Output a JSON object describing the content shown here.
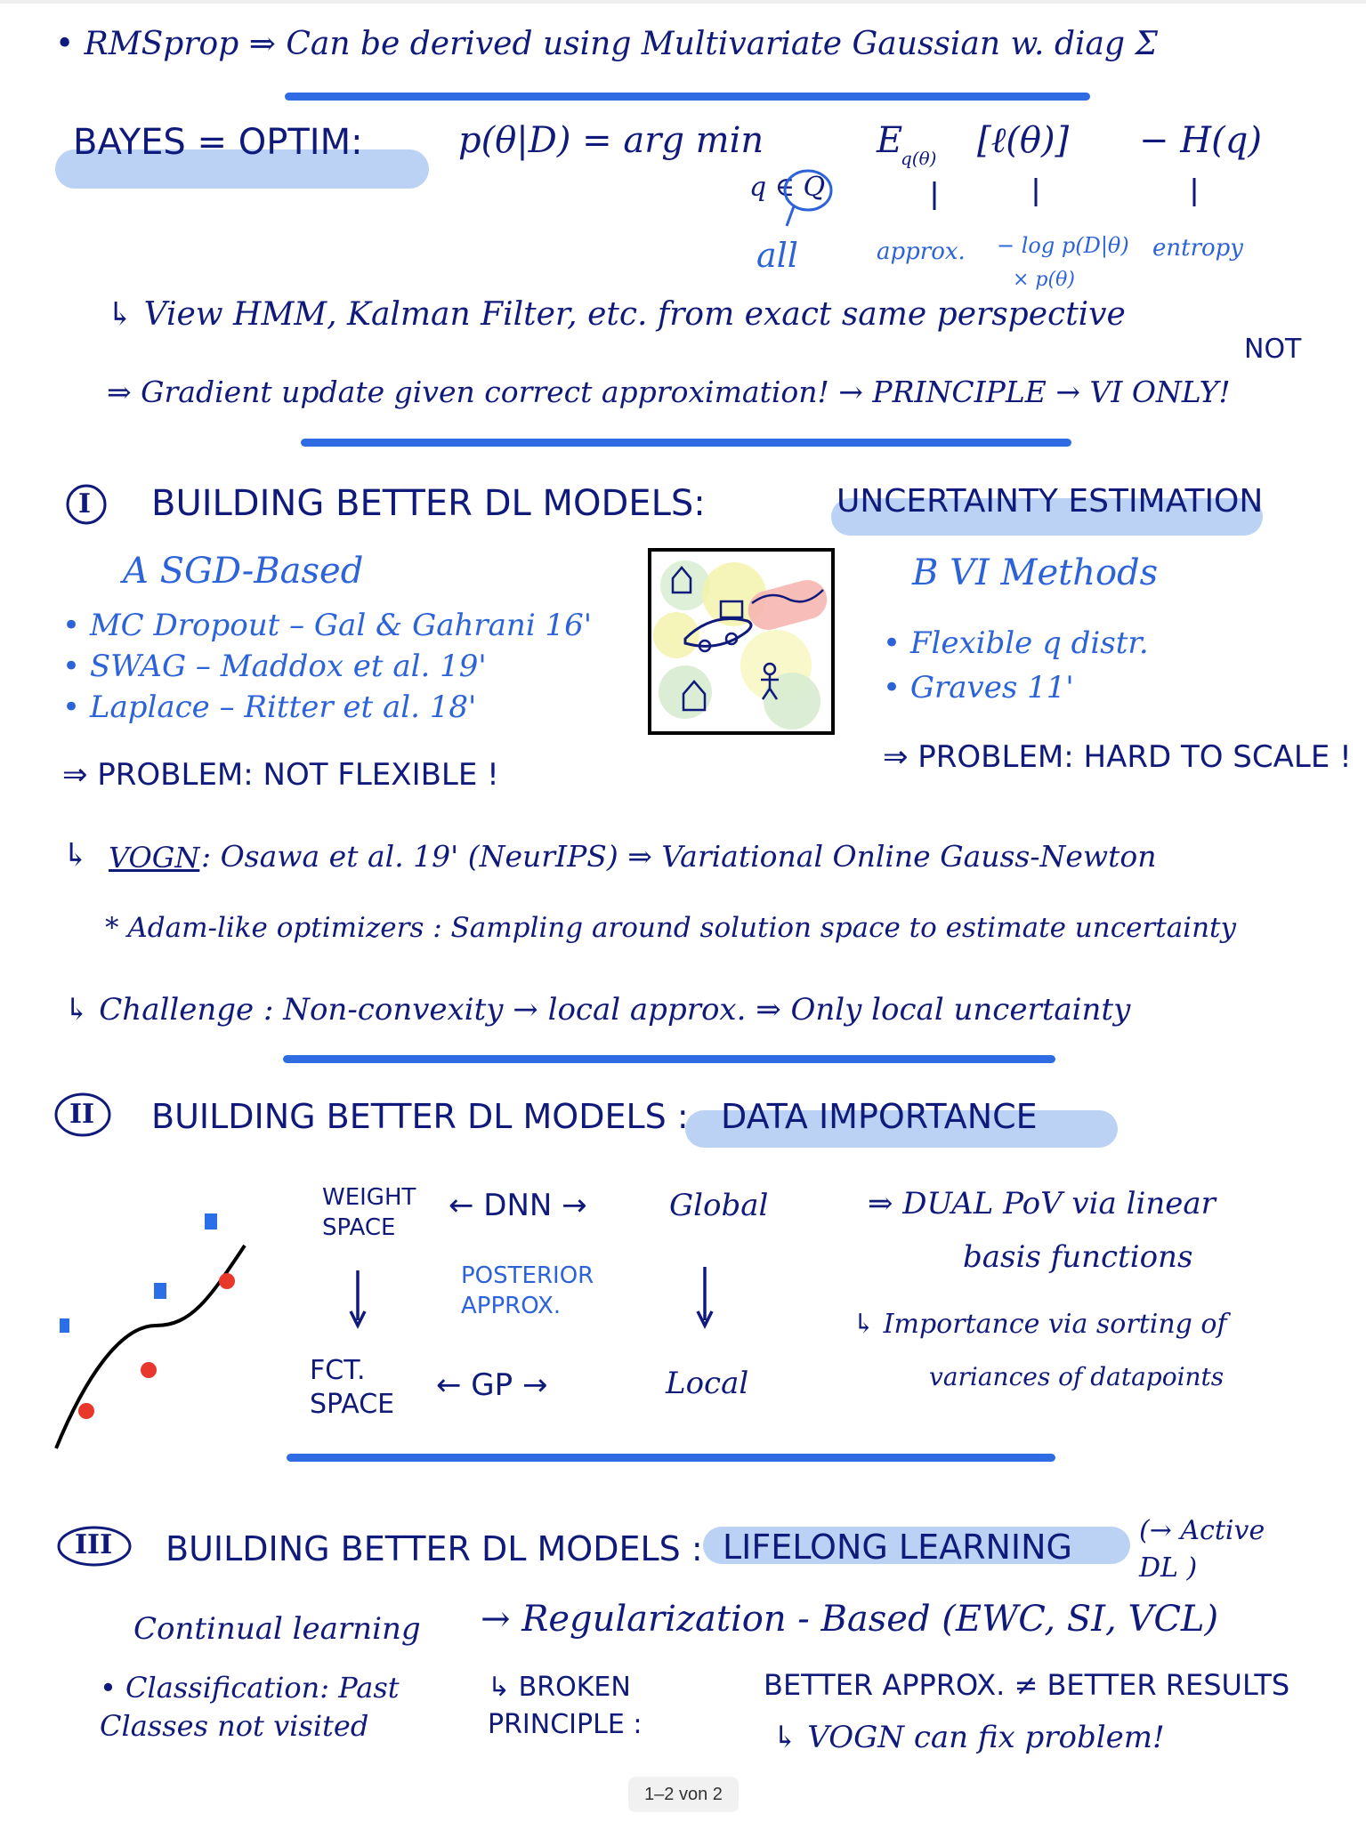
{
  "notes": {
    "line1": "• RMSprop ⇒ Can be derived using Multivariate Gaussian w. diag Σ",
    "bayes_label": "BAYES = OPTIM:",
    "bayes_formula": "p(θ|D) = arg min",
    "bayes_sub": "q ∈ Q",
    "expectation": "E",
    "expectation_sub": "q(θ)",
    "loss_term": "[ℓ(θ)]",
    "entropy_term": "− H(q)",
    "ann_all": "all",
    "ann_approx": "approx.",
    "ann_loss": "− log p(D|θ)",
    "ann_loss2": "× p(θ)",
    "ann_entropy": "entropy",
    "view_line": "↳ View HMM, Kalman Filter, etc. from exact same perspective",
    "not_label": "NOT",
    "gradient_line": "⇒ Gradient update given correct approximation! → PRINCIPLE → VI ONLY!",
    "section1_num": "I",
    "section1_title": "BUILDING BETTER DL MODELS:",
    "section1_highlight": "UNCERTAINTY ESTIMATION",
    "sgd_heading": "A SGD-Based",
    "sgd_items": [
      "• MC Dropout – Gal & Gahrani 16'",
      "• SWAG – Maddox et al. 19'",
      "• Laplace – Ritter et al. 18'"
    ],
    "sgd_problem": "⇒ PROBLEM: NOT FLEXIBLE !",
    "vi_heading": "B VI Methods",
    "vi_items": [
      "• Flexible q distr.",
      "• Graves 11'"
    ],
    "vi_problem": "⇒ PROBLEM: HARD TO SCALE !",
    "vogn_prefix": "↳",
    "vogn_label": "VOGN",
    "vogn_line": ": Osawa et al. 19' (NeurIPS) ⇒ Variational Online Gauss-Newton",
    "adam_line": "* Adam-like optimizers : Sampling around solution space to estimate uncertainty",
    "challenge_line": "↳ Challenge : Non-convexity → local approx. ⇒ Only local uncertainty",
    "section2_num": "II",
    "section2_title": "BUILDING BETTER DL MODELS :",
    "section2_highlight": "DATA IMPORTANCE",
    "ws_label": "WEIGHT\nSPACE",
    "dnn": "← DNN →",
    "global": "Global",
    "posterior": "POSTERIOR\nAPPROX.",
    "fct_label": "FCT.\nSPACE",
    "gp": "← GP →",
    "local": "Local",
    "dual_line1": "⇒ DUAL PoV via linear",
    "dual_line2": "basis functions",
    "importance_line1": "↳ Importance via sorting of",
    "importance_line2": "variances of datapoints",
    "section3_num": "III",
    "section3_title": "BUILDING BETTER DL MODELS :",
    "section3_highlight": "LIFELONG LEARNING",
    "active_dl": "(→ Active\nDL )",
    "continual": "Continual learning",
    "regularization": "→ Regularization - Based (EWC, SI, VCL)",
    "classification": "• Classification: Past\nClasses not visited",
    "broken": "↳ BROKEN\nPRINCIPLE :",
    "better": "BETTER APPROX. ≠ BETTER RESULTS",
    "vogn_fix": "↳ VOGN can fix problem!",
    "page_indicator": "1–2 von 2"
  },
  "colors": {
    "ink": "#0f1a7a",
    "light_ink": "#2d63d8",
    "highlight": "#bcd2f4",
    "rule": "#2f6be3",
    "red_dot": "#e8372b",
    "blue_square": "#2a6ee8"
  }
}
